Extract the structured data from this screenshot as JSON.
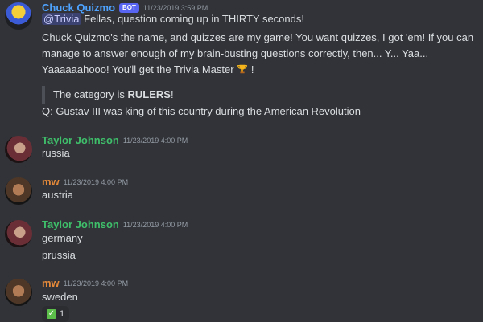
{
  "messages": [
    {
      "author": "Chuck Quizmo",
      "bot_tag": "BOT",
      "timestamp": "11/23/2019 3:59 PM",
      "mention": "@Trivia",
      "line1": "Fellas, question coming up in THIRTY seconds!",
      "line2": "Chuck Quizmo's the name, and quizzes are my game! You want quizzes, I got 'em! If you can manage to answer enough of my brain-busting questions correctly, then... Y... Yaa... Yaaaaaahooo! You'll get the Trivia Master",
      "line2_end": "!",
      "quote_prefix": "The category is ",
      "quote_bold": "RULERS",
      "quote_suffix": "!",
      "question": "Q: Gustav III was king of this country during the American Revolution"
    },
    {
      "author": "Taylor Johnson",
      "timestamp": "11/23/2019 4:00 PM",
      "text": "russia"
    },
    {
      "author": "mw",
      "timestamp": "11/23/2019 4:00 PM",
      "text": "austria"
    },
    {
      "author": "Taylor Johnson",
      "timestamp": "11/23/2019 4:00 PM",
      "text": "germany",
      "text2": "prussia"
    },
    {
      "author": "mw",
      "timestamp": "11/23/2019 4:00 PM",
      "text": "sweden",
      "reaction_count": "1"
    }
  ],
  "colors": {
    "bg": "#313338",
    "chuck": "#4ea3ff",
    "taylor": "#3fbf6a",
    "mw": "#e68a3a",
    "bot_badge": "#5865f2"
  },
  "icons": {
    "trophy": "trophy-icon",
    "reaction": "check-mark-icon"
  }
}
